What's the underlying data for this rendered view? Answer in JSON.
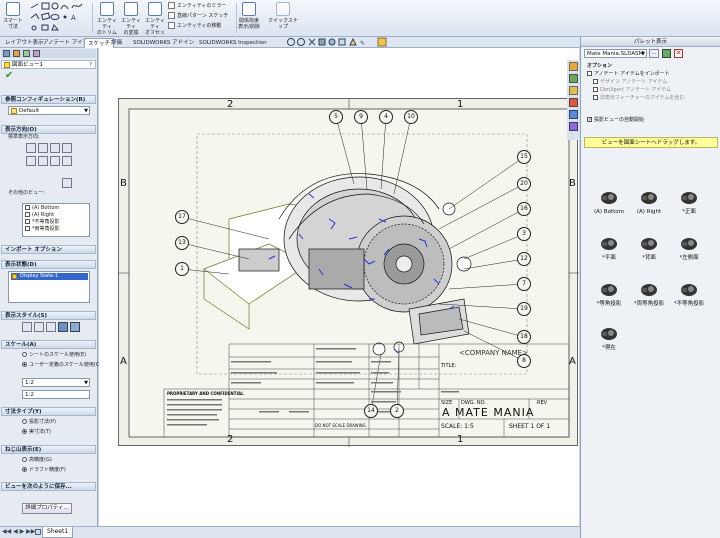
{
  "ribbon": {
    "smart_dimension": "スマート寸法",
    "entity_convert": "エンティティ\nの変換",
    "entity_trim": "エンティティ\nのトリム",
    "entity_offset": "エンティティ\nオフセット",
    "mirror_entities": "エンティティのミラー",
    "linear_pattern": "直線パターン スケッチ",
    "move_entities": "エンティティの移動",
    "display_relations": "関係拘束\n表示/削除",
    "quick_snap": "クイックスナップ"
  },
  "tabs": [
    "レイアウト表示",
    "アノテート アイテム",
    "スケッチ",
    "評価",
    "SOLIDWORKS アドイン",
    "SOLIDWORKS Inspection"
  ],
  "active_tab": "スケッチ",
  "left": {
    "title": "図面ビュー1",
    "ref_config_head": "参照コンフィギュレーション(R)",
    "ref_config_value": "Default",
    "orientation_head": "表示方向(O)",
    "standard_views": "標準表示方向:",
    "other_views": "その他のビュー:",
    "view_list": [
      "(A) Bottom",
      "(A) Right",
      "*不等角投影",
      "*両等角投影"
    ],
    "import_head": "インポート オプション",
    "display_state_head": "表示状態(D)",
    "display_state_value": "Display State-1",
    "display_style_head": "表示スタイル(S)",
    "scale_head": "スケール(A)",
    "scale_opt1": "シートのスケール使用(E)",
    "scale_opt2": "ユーザー定義のスケール使用(C)",
    "scale_value": "1:2",
    "scale_value2": "1:2",
    "dim_type_head": "寸法タイプ(Y)",
    "dim_opt1": "投影寸法(P)",
    "dim_opt2": "実寸法(T)",
    "cosmetic_head": "ねじ山表示(E)",
    "cosmetic_opt1": "高精度(G)",
    "cosmetic_opt2": "ドラフト精度(F)",
    "save_head": "ビューを次のように保存...",
    "more_props": "詳細プロパティ..."
  },
  "drawing": {
    "col_labels": [
      "2",
      "1"
    ],
    "row_labels": [
      "B",
      "A"
    ],
    "balloons": [
      "5",
      "9",
      "4",
      "10",
      "15",
      "20",
      "16",
      "3",
      "12",
      "17",
      "13",
      "1",
      "7",
      "19",
      "18",
      "8",
      "14",
      "2"
    ],
    "company": "<COMPANY NAME>",
    "title_label": "TITLE:",
    "size_label": "SIZE",
    "size_value": "A",
    "dwg_no_label": "DWG.  NO.",
    "rev_label": "REV",
    "title_value": "MATE MANIA",
    "scale_text": "SCALE: 1:5",
    "sheet_text": "SHEET 1 OF 1",
    "proprietary": "PROPRIETARY AND CONFIDENTIAL",
    "do_not_scale": "DO NOT SCALE DRAWING"
  },
  "bottom": {
    "sheet_tab": "Sheet1"
  },
  "right": {
    "title": "パレット表示",
    "file_value": "Mate Mania.SLDASM",
    "more_btn": "...",
    "options_label": "オプション",
    "opt_import_annot": "アノテート アイテムをインポート",
    "opt_design": "デザイン アノテート アイテム",
    "opt_dimxpert": "DimXpert アノテート アイテム",
    "opt_hidden": "非表示フィーチャーのアイテムを含む",
    "opt_auto_start": "投影ビューの自動開始",
    "hint": "ビューを図面シートへドラッグします。",
    "views": [
      {
        "label": "(A) Bottom"
      },
      {
        "label": "(A) Right"
      },
      {
        "label": "*正面"
      },
      {
        "label": "*平面"
      },
      {
        "label": "*背面"
      },
      {
        "label": "*左側面"
      },
      {
        "label": "*等角投影"
      },
      {
        "label": "*両等角投影"
      },
      {
        "label": "*不等角投影"
      },
      {
        "label": "*現在"
      }
    ]
  },
  "colors": {
    "accent": "#2f5fa8",
    "hint_bg": "#ffff99",
    "sheet_bg": "#f0f0e8",
    "model_lines": "#1a1a1a",
    "balloon": "#222222"
  }
}
